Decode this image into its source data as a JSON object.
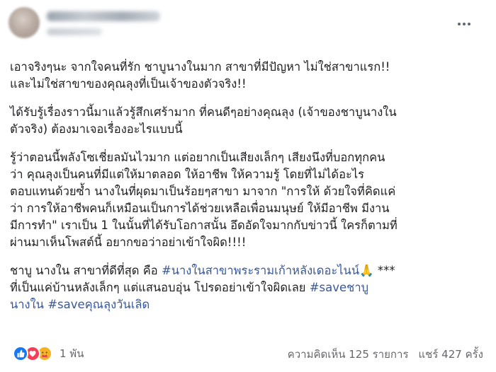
{
  "post": {
    "paragraphs": [
      [
        [
          {
            "text": "เอาจริงๆนะ จากใจคนที่รัก ชาบูนางในมาก สาขาที่มีปัญหา ไม่ใช่สาขาแรก!!"
          }
        ],
        [
          {
            "text": "และไม่ใช่สาขาของคุณลุงที่เป็นเจ้าของตัวจริง!!"
          }
        ]
      ],
      [
        [
          {
            "text": "ได้รับรู้เรื่องราวนี้มาแล้วรู้สึกเศร้ามาก ที่คนดีๆอย่างคุณลุง (เจ้าของชาบูนางใน"
          }
        ],
        [
          {
            "text": "ตัวจริง) ต้องมาเจอเรื่องอะไรแบบนี้"
          }
        ]
      ],
      [
        [
          {
            "text": "รู้ว่าตอนนี้พลังโซเชี่ยลมันไวมาก แต่อยากเป็นเสียงเล็กๆ เสียงนึงที่บอกทุกคน"
          }
        ],
        [
          {
            "text": "ว่า คุณลุงเป็นคนที่มีแต่ให้มาตลอด ให้อาชีพ ให้ความรู้ โดยที่ไม่ได้อะไร"
          }
        ],
        [
          {
            "text": "ตอบแทนด้วยซ้ำ  นางในที่ผุดมาเป็นร้อยๆสาขา มาจาก \"การให้ ด้วยใจที่คิดแค่"
          }
        ],
        [
          {
            "text": "ว่า การให้อาชีพคนก็เหมือนเป็นการได้ช่วยเหลือเพื่อนมนุษย์ ให้มีอาชีพ มีงาน"
          }
        ],
        [
          {
            "text": "มีการทำ\" เราเป็น 1 ในนั้นที่ได้รับโอกาสนั้น อึดอัดใจมากกับข่าวนี้ ใครก็ตามที่"
          }
        ],
        [
          {
            "text": "ผ่านมาเห็นโพสต์นี้ อยากขอว่าอย่าเข้าใจผิด!!!!"
          }
        ]
      ],
      [
        [
          {
            "text": "ชาบู นางใน สาขาที่ดีที่สุด คือ "
          },
          {
            "text": "#นางในสาขาพระรามเก้าหลังเดอะไนน์",
            "tag": true
          },
          {
            "text": "🙏",
            "emoji": true
          },
          {
            "text": " ***"
          }
        ],
        [
          {
            "text": "ที่เป็นแค่บ้านหลังเล็กๆ แต่แสนอบอุ่น โปรดอย่าเข้าใจผิดเลย "
          },
          {
            "text": "#saveชาบู",
            "tag": true
          }
        ],
        [
          {
            "text": "นางใน",
            "tag": true
          },
          {
            "text": " "
          },
          {
            "text": "#saveคุณลุงวันเลิด",
            "tag": true
          }
        ]
      ]
    ]
  },
  "footer": {
    "reaction_count": "1 พัน",
    "comments": "ความคิดเห็น 125 รายการ",
    "shares": "แชร์ 427 ครั้ง"
  },
  "colors": {
    "text": "#1c1e21",
    "hashtag": "#385898",
    "secondary": "#65676b",
    "like": "#1877f2",
    "love": "#f33e58",
    "care": "#f7b125"
  },
  "icons": [
    "more-options-icon",
    "like-reaction-icon",
    "love-reaction-icon",
    "care-reaction-icon",
    "pray-emoji-icon"
  ]
}
